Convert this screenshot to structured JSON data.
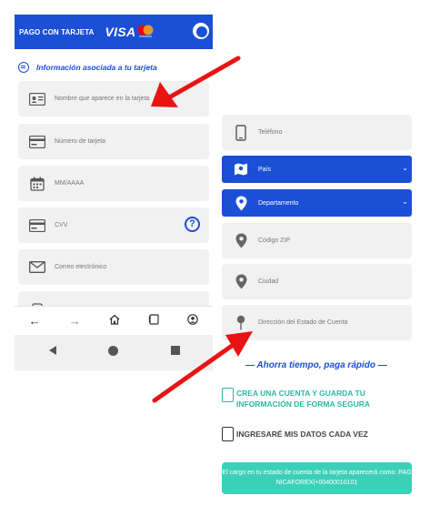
{
  "left_screen": {
    "header": {
      "title": "PAGO CON TARJETA",
      "brand": "VISA"
    },
    "section_title": "Información asociada a tu tarjeta",
    "fields": [
      {
        "icon": "id-card-icon",
        "placeholder": "Nombre que aparece en la tarjeta"
      },
      {
        "icon": "credit-card-icon",
        "placeholder": "Número de tarjeta"
      },
      {
        "icon": "calendar-icon",
        "placeholder": "MM/AAAA"
      },
      {
        "icon": "credit-card-icon",
        "placeholder": "CVV"
      },
      {
        "icon": "mail-icon",
        "placeholder": "Correo electrónico"
      }
    ],
    "help_label": "?"
  },
  "right_screen": {
    "phone_placeholder": "Teléfono",
    "country_label": "País",
    "department_label": "Departamento",
    "zip_placeholder": "Código ZIP",
    "city_placeholder": "Ciudad",
    "address_placeholder": "Dirección del Estado de Cuenta",
    "promo": "— Ahorra tiempo, paga rápido —",
    "create_account": "CREA UNA CUENTA Y GUARDA TU INFORMACIÓN DE FORMA SEGURA",
    "enter_each_time": "INGRESARÉ MIS DATOS CADA VEZ",
    "notice": "El cargo en tu estado de cuenta de la tarjeta aparecerá como: PAG NICAFOREX|+00400010101"
  },
  "colors": {
    "brand_blue": "#1a4fd6",
    "teal": "#3dd0b8",
    "arrow_red": "#e81414"
  }
}
